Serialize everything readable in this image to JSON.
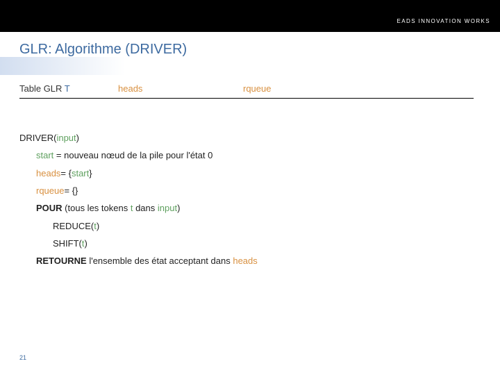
{
  "brand": {
    "line1": "EADS INNOVATION WORKS"
  },
  "title": "GLR: Algorithme (DRIVER)",
  "defs": {
    "col1_pre": "Table GLR ",
    "col1_var": "T",
    "col2": "heads",
    "col3": "rqueue"
  },
  "algo": {
    "l1_a": "DRIVER(",
    "l1_b": "input",
    "l1_c": ")",
    "l2_a": "start",
    "l2_b": " = nouveau nœud de la pile pour l'état 0",
    "l3_a": "heads",
    "l3_b": "= {",
    "l3_c": "start",
    "l3_d": "}",
    "l4_a": "rqueue",
    "l4_b": "= {}",
    "l5_a": "POUR",
    "l5_b": " (tous les tokens ",
    "l5_c": "t",
    "l5_d": " dans ",
    "l5_e": "input",
    "l5_f": ")",
    "l6_a": "REDUCE(",
    "l6_b": "t",
    "l6_c": ")",
    "l7_a": "SHIFT(",
    "l7_b": "t",
    "l7_c": ")",
    "l8_a": "RETOURNE",
    "l8_b": " l'ensemble des état acceptant dans ",
    "l8_c": "heads"
  },
  "page": "21"
}
